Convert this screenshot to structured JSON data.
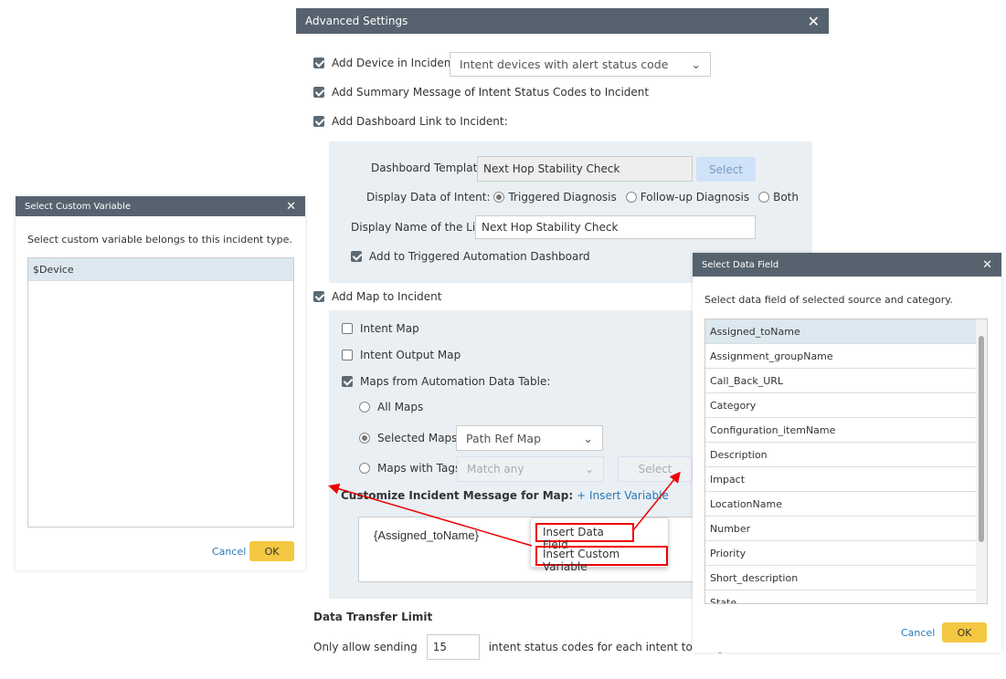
{
  "advanced": {
    "title": "Advanced Settings",
    "add_device_label": "Add Device in Incident:",
    "add_device_value": "Intent devices with alert status code",
    "add_summary_label": "Add Summary Message of Intent Status Codes to Incident",
    "add_dashboard_label": "Add Dashboard Link to Incident:",
    "dashboard_template_label": "Dashboard Template:",
    "dashboard_template_value": "Next Hop Stability Check",
    "select_label": "Select",
    "display_data_label": "Display Data of Intent:",
    "radio_triggered": "Triggered Diagnosis",
    "radio_followup": "Follow-up Diagnosis",
    "radio_both": "Both",
    "display_name_label": "Display Name of the Link:",
    "display_name_value": "Next Hop Stability Check",
    "add_triggered_label": "Add to Triggered Automation Dashboard",
    "add_map_label": "Add Map to Incident",
    "intent_map": "Intent Map",
    "intent_output_map": "Intent Output Map",
    "maps_from_table": "Maps from Automation Data Table:",
    "all_maps": "All Maps",
    "selected_maps": "Selected Maps:",
    "selected_maps_value": "Path Ref Map",
    "maps_with_tags": "Maps with Tags:",
    "match_any": "Match any",
    "tags_select": "Select",
    "customize_label": "Customize Incident Message for Map:",
    "insert_variable": "+ Insert Variable",
    "message_value": "{Assigned_toName}",
    "menu_data_field": "Insert Data Field",
    "menu_custom_variable": "Insert Custom Variable",
    "data_transfer_title": "Data Transfer Limit",
    "only_allow": "Only allow sending",
    "limit_value": "15",
    "limit_suffix": "intent status codes for each intent to integrate"
  },
  "custom_var": {
    "title": "Select Custom Variable",
    "instruction": "Select custom variable belongs to this incident type.",
    "items": [
      "$Device"
    ],
    "cancel": "Cancel",
    "ok": "OK"
  },
  "data_field": {
    "title": "Select Data Field",
    "instruction": "Select data field of selected source and category.",
    "items": [
      "Assigned_toName",
      "Assignment_groupName",
      "Call_Back_URL",
      "Category",
      "Configuration_itemName",
      "Description",
      "Impact",
      "LocationName",
      "Number",
      "Priority",
      "Short_description",
      "State"
    ],
    "cancel": "Cancel",
    "ok": "OK"
  },
  "colors": {
    "titlebar": "#56636e",
    "accent": "#2a7ab8",
    "ok": "#f5c842",
    "annotation": "#e00000"
  }
}
